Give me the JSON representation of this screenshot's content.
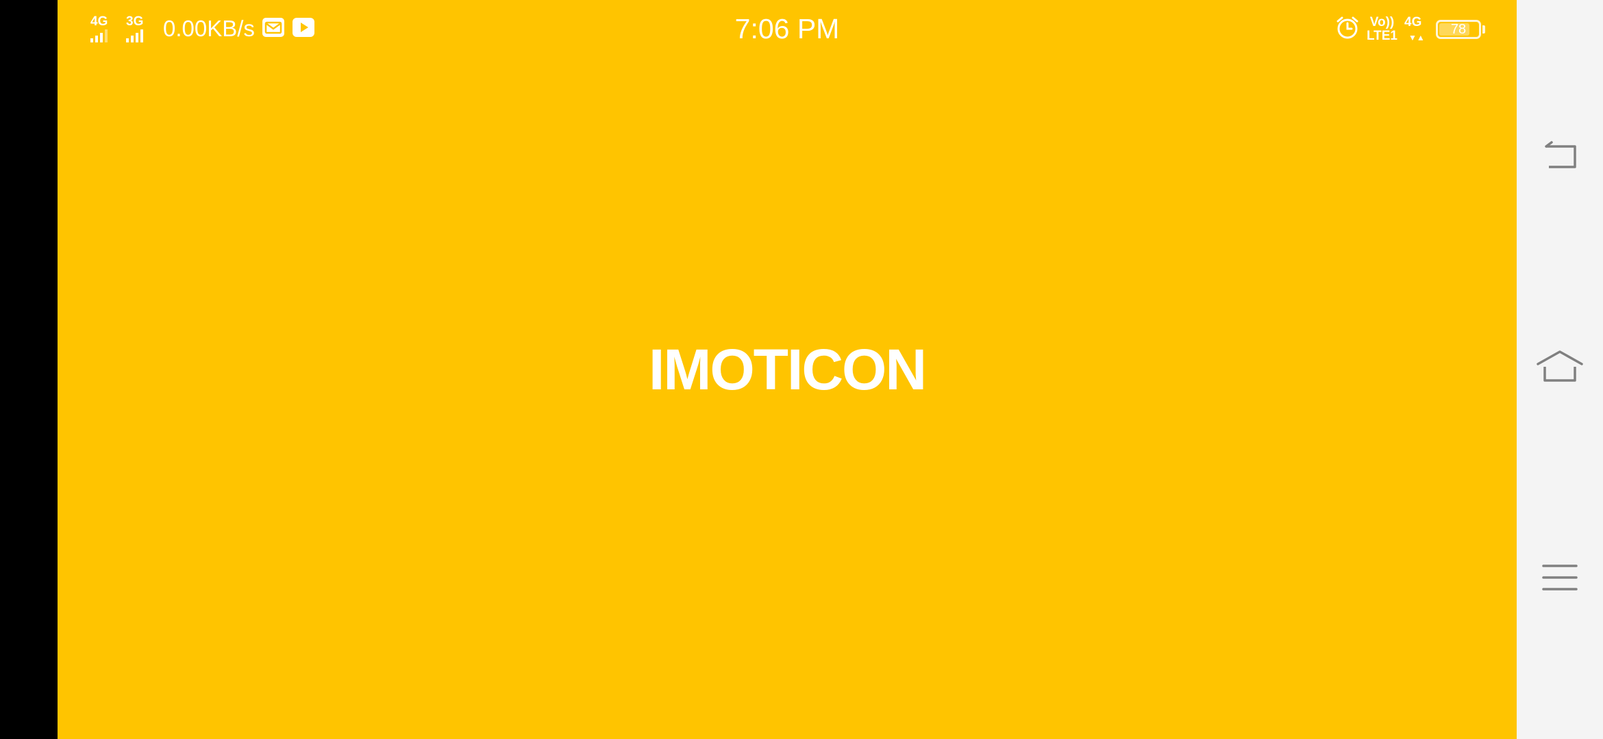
{
  "colors": {
    "splash_background": "#FFC400",
    "status_text": "#FFFFFF",
    "navbar_background": "#F4F4F4",
    "navbar_icons": "#808080"
  },
  "status_bar": {
    "sim1_network": "4G",
    "sim2_network": "3G",
    "data_speed": "0.00KB/s",
    "notification_icons": [
      "mail-notification-icon",
      "youtube-notification-icon"
    ],
    "time": "7:06 PM",
    "alarm_icon": "alarm-clock-icon",
    "volte_top": "Vo))",
    "volte_bottom": "LTE1",
    "data_network": "4G",
    "data_arrows": "▼▲",
    "battery_level": "78",
    "battery_fraction": 0.78
  },
  "splash": {
    "title": "IMOTICON"
  },
  "navigation_bar": {
    "buttons": [
      "back-icon",
      "home-icon",
      "menu-icon"
    ]
  }
}
